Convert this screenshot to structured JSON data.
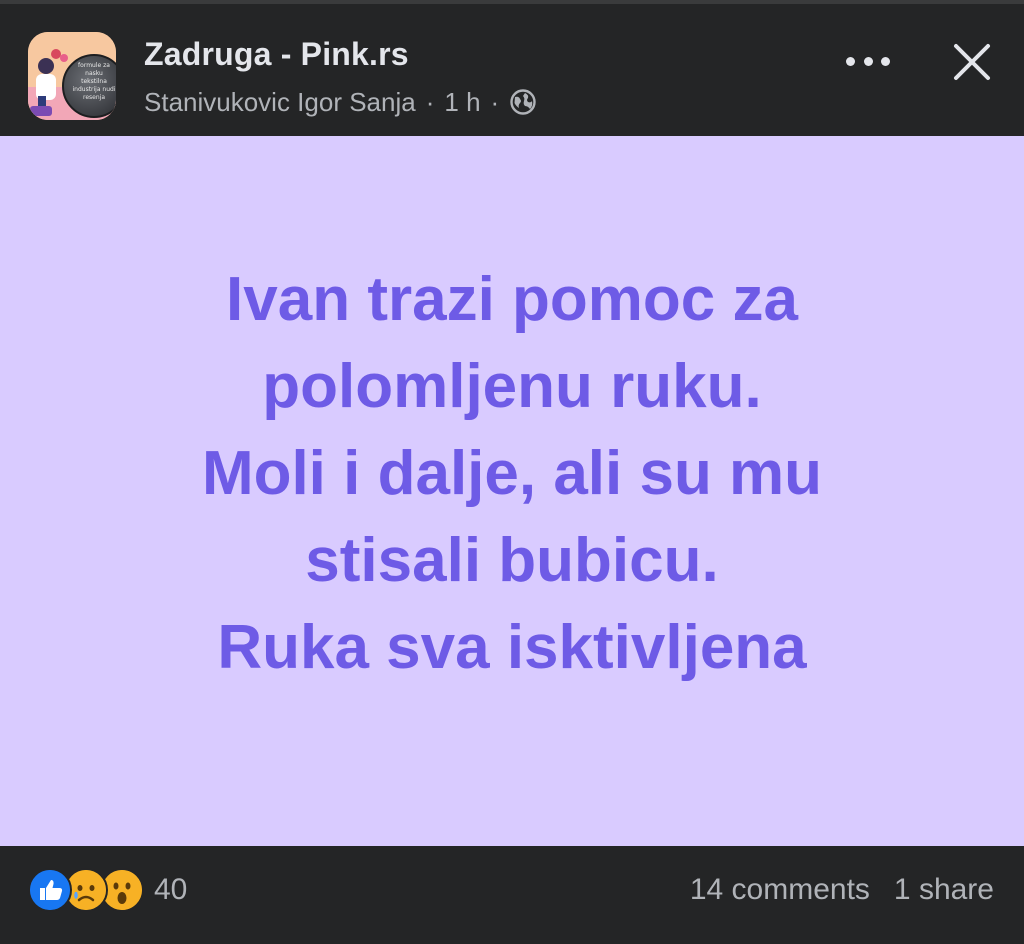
{
  "header": {
    "page_name": "Zadruga - Pink.rs",
    "author": "Stanivukovic Igor Sanja",
    "separator": "·",
    "time": "1 h",
    "privacy_icon": "globe-icon",
    "avatar_text": "formule za nasku tekstilna industrija nudi resenja",
    "more_icon": "more-horizontal-icon",
    "close_icon": "close-icon"
  },
  "post": {
    "background_color": "#d9cbff",
    "text_color": "#6e5be6",
    "lines": [
      "Ivan trazi pomoc za",
      "polomljenu ruku.",
      "Moli i dalje, ali su mu",
      "stisali bubicu.",
      "Ruka sva isktivljena"
    ]
  },
  "footer": {
    "reactions": [
      "like-icon",
      "sad-icon",
      "wow-icon"
    ],
    "reaction_count": "40",
    "comments": "14 comments",
    "shares": "1 share"
  },
  "colors": {
    "dark_bg": "#242526",
    "text_primary": "#e4e6eb",
    "text_secondary": "#b0b3b8",
    "like_blue": "#1877f2",
    "emoji_yellow": "#f7b125"
  }
}
